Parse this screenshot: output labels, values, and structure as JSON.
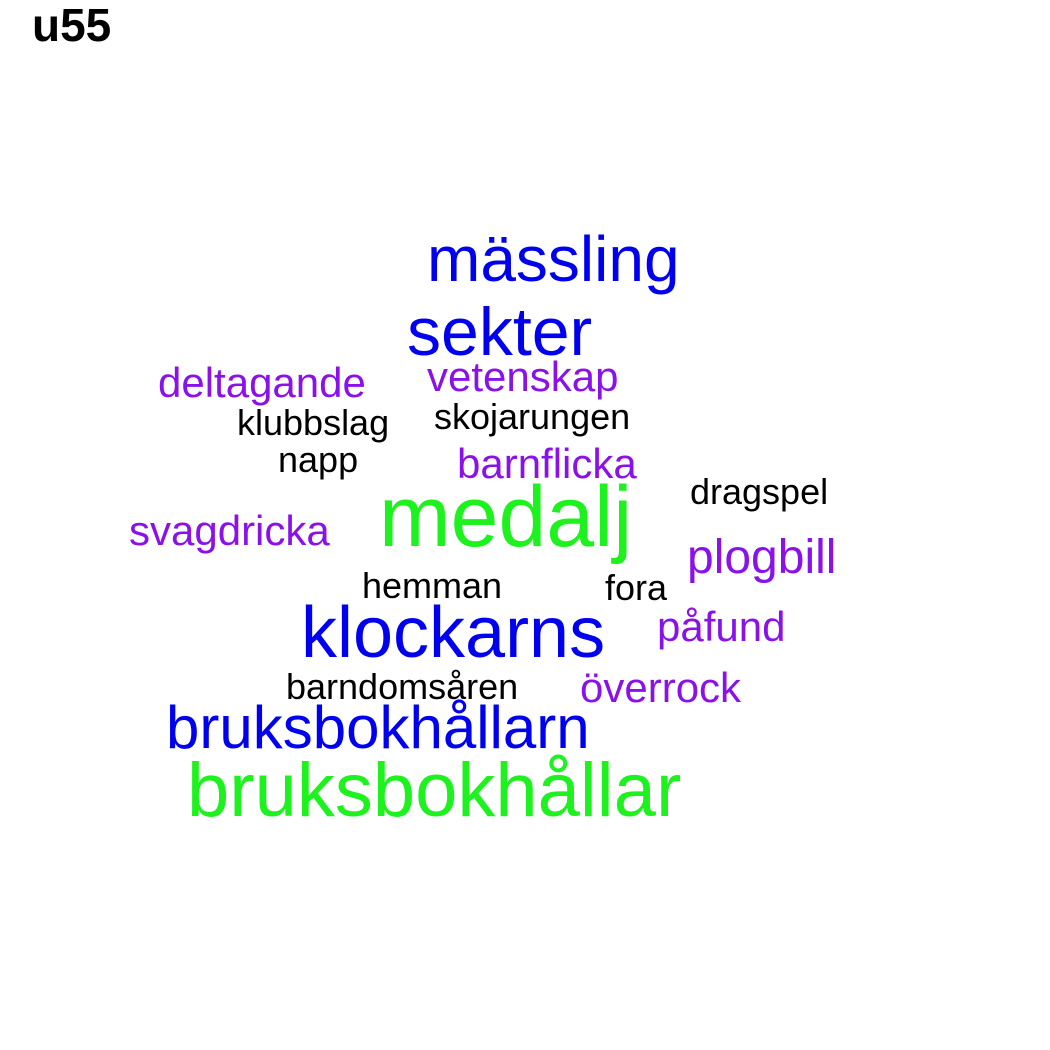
{
  "title": "u55",
  "colors": {
    "black": "#000000",
    "blue": "#0000ee",
    "purple": "#8a12e8",
    "green": "#1ef21e"
  },
  "words": {
    "massling": "mässling",
    "sekter": "sekter",
    "deltagande": "deltagande",
    "vetenskap": "vetenskap",
    "klubbslag": "klubbslag",
    "skojarungen": "skojarungen",
    "napp": "napp",
    "barnflicka": "barnflicka",
    "dragspel": "dragspel",
    "medalj": "medalj",
    "svagdricka": "svagdricka",
    "plogbill": "plogbill",
    "hemman": "hemman",
    "fora": "fora",
    "klockarns": "klockarns",
    "pafund": "påfund",
    "barndomsaren": "barndomsåren",
    "overrock": "överrock",
    "bruksbokhallarn": "bruksbokhållarn",
    "bruksbokhallar": "bruksbokhållar"
  }
}
